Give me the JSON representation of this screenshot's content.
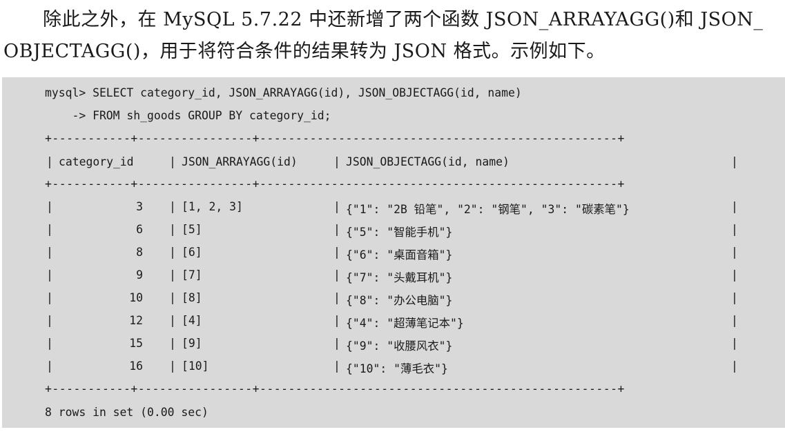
{
  "paragraph": {
    "line1": "除此之外，在 MySQL 5.7.22 中还新增了两个函数 JSON_ARRAYAGG()和 JSON_",
    "line2": "OBJECTAGG()，用于将符合条件的结果转为 JSON 格式。示例如下。"
  },
  "code": {
    "prompt_line": "mysql> SELECT category_id, JSON_ARRAYAGG(id), JSON_OBJECTAGG(id, name)",
    "continuation_line": "    -> FROM sh_goods GROUP BY category_id;",
    "separator": "+-----------+----------------+--------------------------------------------------+",
    "columns": [
      "category_id",
      "JSON_ARRAYAGG(id)",
      "JSON_OBJECTAGG(id, name)"
    ],
    "bar": "|",
    "rows": [
      {
        "category_id": "3",
        "arrayagg": "[1, 2, 3]",
        "objectagg": "{\"1\": \"2B 铅笔\", \"2\": \"钢笔\", \"3\": \"碳素笔\"}"
      },
      {
        "category_id": "6",
        "arrayagg": "[5]",
        "objectagg": "{\"5\": \"智能手机\"}"
      },
      {
        "category_id": "8",
        "arrayagg": "[6]",
        "objectagg": "{\"6\": \"桌面音箱\"}"
      },
      {
        "category_id": "9",
        "arrayagg": "[7]",
        "objectagg": "{\"7\": \"头戴耳机\"}"
      },
      {
        "category_id": "10",
        "arrayagg": "[8]",
        "objectagg": "{\"8\": \"办公电脑\"}"
      },
      {
        "category_id": "12",
        "arrayagg": "[4]",
        "objectagg": "{\"4\": \"超薄笔记本\"}"
      },
      {
        "category_id": "15",
        "arrayagg": "[9]",
        "objectagg": "{\"9\": \"收腰风衣\"}"
      },
      {
        "category_id": "16",
        "arrayagg": "[10]",
        "objectagg": "{\"10\": \"薄毛衣\"}"
      }
    ],
    "footer": "8 rows in set (0.00 sec)"
  }
}
